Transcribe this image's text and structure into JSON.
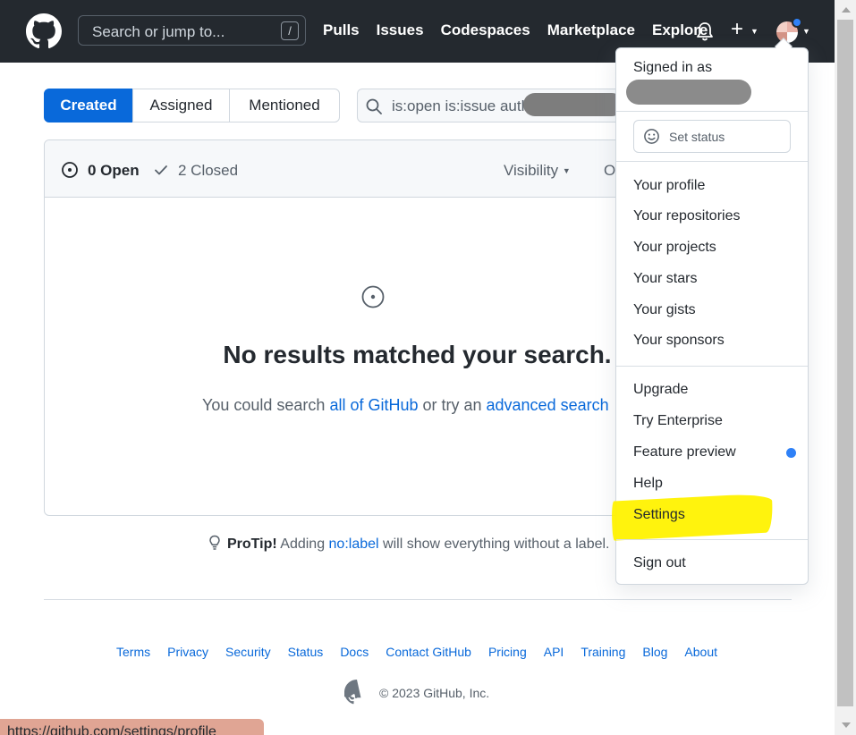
{
  "header": {
    "search_placeholder": "Search or jump to...",
    "search_shortcut": "/",
    "nav": [
      "Pulls",
      "Issues",
      "Codespaces",
      "Marketplace",
      "Explore"
    ],
    "plus_symbol": "+"
  },
  "filters": {
    "tabs": [
      "Created",
      "Assigned",
      "Mentioned"
    ],
    "query": "is:open is:issue auth"
  },
  "issues": {
    "open_label": "0 Open",
    "closed_label": "2 Closed",
    "visibility_label": "Visibility",
    "org_label_partial": "O",
    "blank_title": "No results matched your search.",
    "blank_text_1": "You could search ",
    "blank_link_1": "all of GitHub",
    "blank_text_2": " or try an ",
    "blank_link_2": "advanced search"
  },
  "protip": {
    "label": "ProTip!",
    "text_1": " Adding ",
    "link": "no:label",
    "text_2": " will show everything without a label."
  },
  "footer": {
    "links": [
      "Terms",
      "Privacy",
      "Security",
      "Status",
      "Docs",
      "Contact GitHub",
      "Pricing",
      "API",
      "Training",
      "Blog",
      "About"
    ],
    "copyright": "© 2023 GitHub, Inc."
  },
  "status_url": "https://github.com/settings/profile",
  "user_menu": {
    "signed_in_as": "Signed in as",
    "set_status": "Set status",
    "section1": [
      "Your profile",
      "Your repositories",
      "Your projects",
      "Your stars",
      "Your gists",
      "Your sponsors"
    ],
    "section2": [
      "Upgrade",
      "Try Enterprise",
      "Feature preview",
      "Help",
      "Settings"
    ],
    "sign_out": "Sign out"
  },
  "colors": {
    "header_bg": "#24292f",
    "accent": "#0969da",
    "highlight": "#fff200",
    "notification_dot": "#2f81f7"
  }
}
